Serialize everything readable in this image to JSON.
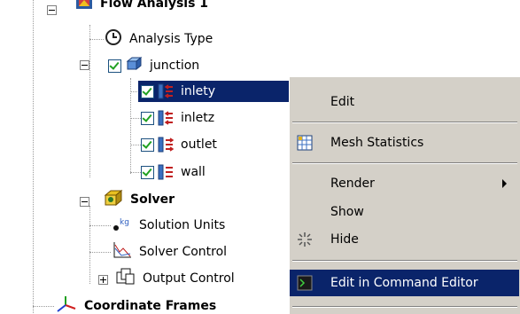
{
  "tree": {
    "items": [
      {
        "label": "Flow Analysis 1"
      },
      {
        "label": "Analysis Type"
      },
      {
        "label": "junction"
      },
      {
        "label": "inlety"
      },
      {
        "label": "inletz"
      },
      {
        "label": "outlet"
      },
      {
        "label": "wall"
      },
      {
        "label": "Solver"
      },
      {
        "label": "Solution Units"
      },
      {
        "label": "Solver Control"
      },
      {
        "label": "Output Control"
      },
      {
        "label": "Coordinate Frames"
      }
    ]
  },
  "context_menu": {
    "items": [
      {
        "label": "Edit"
      },
      {
        "label": "Mesh Statistics"
      },
      {
        "label": "Render"
      },
      {
        "label": "Show"
      },
      {
        "label": "Hide"
      },
      {
        "label": "Edit in Command Editor"
      }
    ],
    "highlighted": "Edit in Command Editor"
  },
  "colors": {
    "selection": "#0a246a",
    "menu_background": "#d4d0c8",
    "checkbox_check": "#21a121"
  }
}
